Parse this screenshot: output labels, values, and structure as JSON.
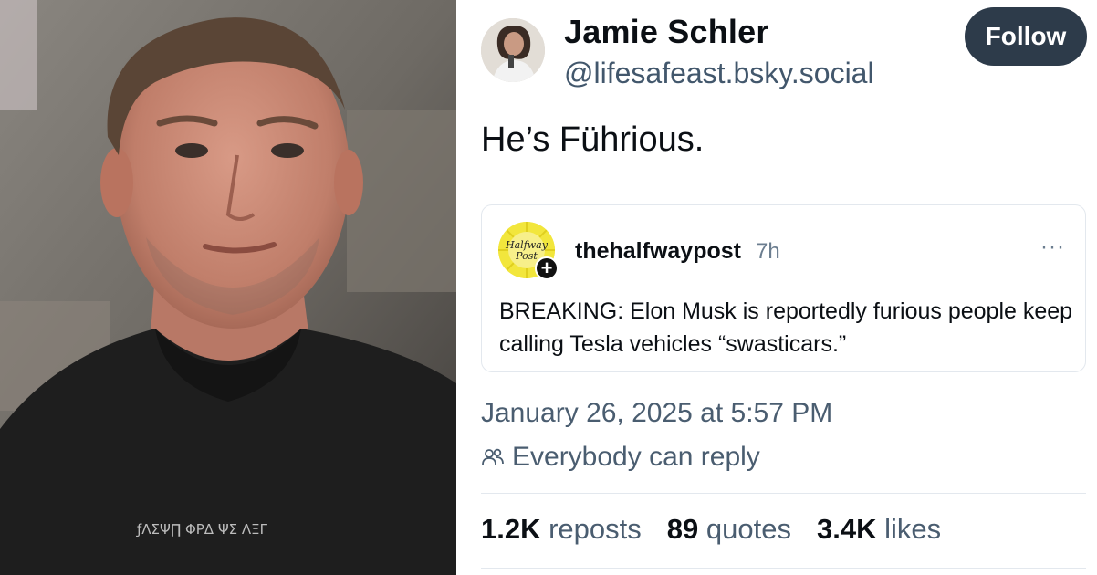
{
  "photo": {
    "shirt_text": "ƒΛΣΨ∏ ΦΡΔ ΨΣ ΛΞΓ"
  },
  "author": {
    "display_name": "Jamie Schler",
    "handle": "@lifesafeast.bsky.social"
  },
  "follow_label": "Follow",
  "post_text": "He’s Führious.",
  "quote": {
    "avatar_text_line1": "Halfway",
    "avatar_text_line2": "Post",
    "author": "thehalfwaypost",
    "time": "7h",
    "more": "···",
    "text": "BREAKING: Elon Musk is reportedly furious people keep calling Tesla vehicles “swasticars.”"
  },
  "timestamp": "January 26, 2025 at 5:57 PM",
  "reply_setting": "Everybody can reply",
  "stats": {
    "reposts_count": "1.2K",
    "reposts_label": "reposts",
    "quotes_count": "89",
    "quotes_label": "quotes",
    "likes_count": "3.4K",
    "likes_label": "likes"
  },
  "colors": {
    "follow_button": "#2d3b4a",
    "secondary_text": "#4a5d70",
    "quote_avatar": "#f2e63c"
  }
}
